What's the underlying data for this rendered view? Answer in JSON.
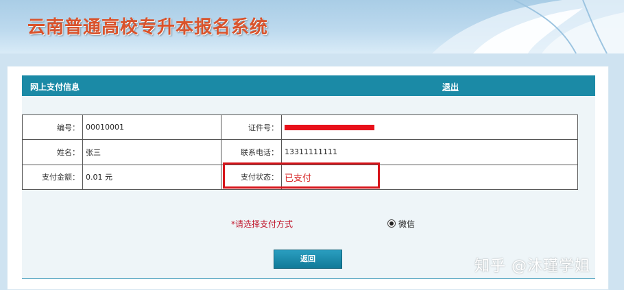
{
  "header": {
    "title": "云南普通高校专升本报名系统"
  },
  "section": {
    "title": "网上支付信息",
    "logout": "退出"
  },
  "info": {
    "id_label": "编号：",
    "id_value": "00010001",
    "cert_label": "证件号：",
    "name_label": "姓名：",
    "name_value": "张三",
    "phone_label": "联系电话：",
    "phone_value": "13311111111",
    "amount_label": "支付金额：",
    "amount_value": "0.01 元",
    "status_label": "支付状态：",
    "status_value": "已支付"
  },
  "payment": {
    "prompt": "*请选择支付方式",
    "option": "微信"
  },
  "actions": {
    "back": "返回"
  },
  "watermark": "知乎 @沐瑾学姐",
  "colors": {
    "bar": "#1b8aa6",
    "title": "#d9532c",
    "alert": "#d62020"
  }
}
